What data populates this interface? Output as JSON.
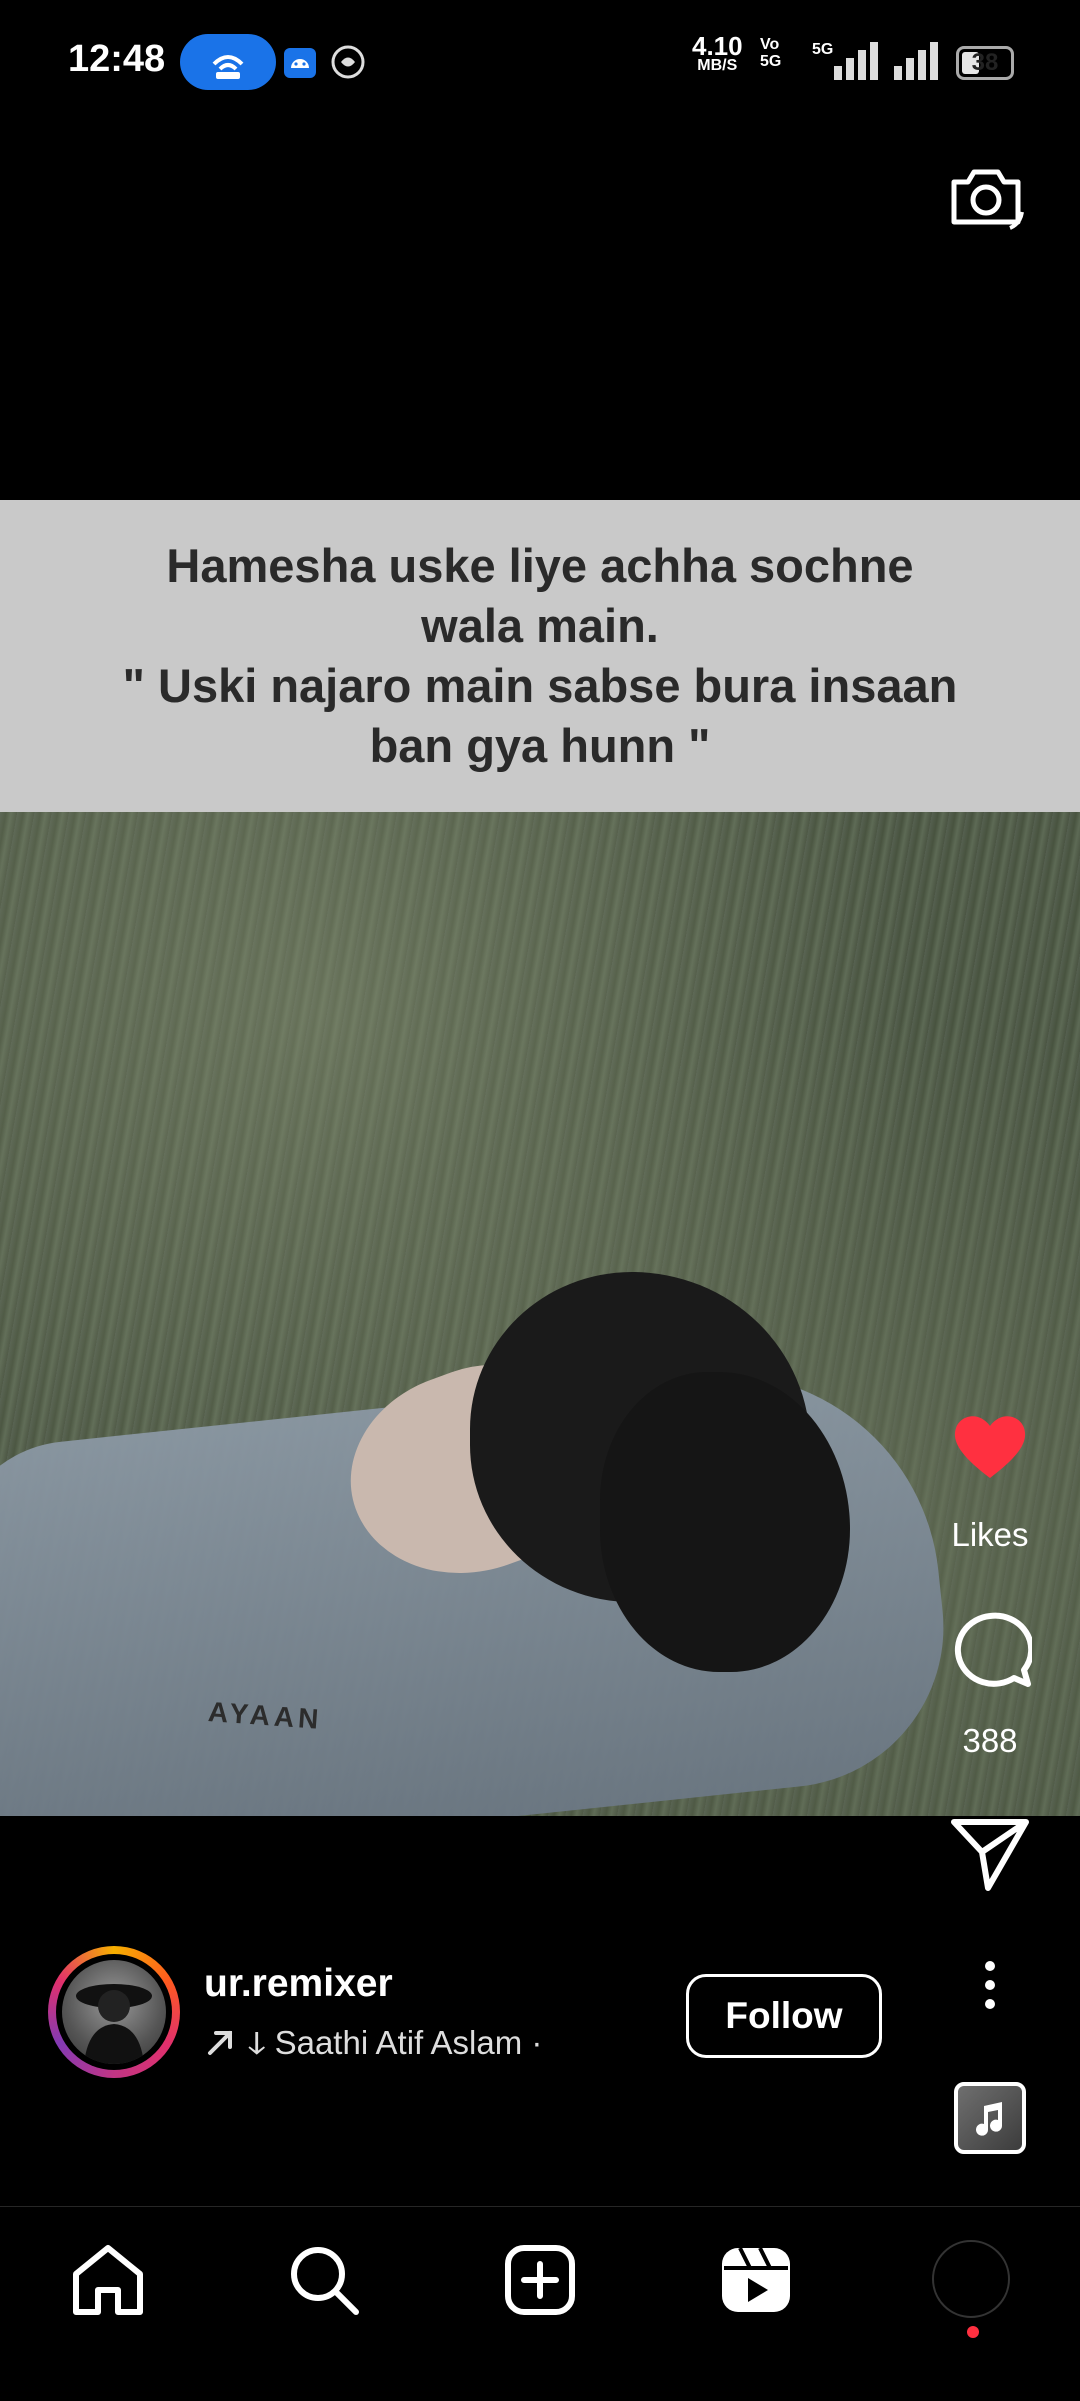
{
  "status_bar": {
    "time": "12:48",
    "net_speed_value": "4.10",
    "net_speed_unit": "MB/S",
    "volte_top": "Vo",
    "volte_bottom": "5G",
    "network": "5G",
    "battery": "38",
    "battery_level": 0.38
  },
  "media": {
    "caption_overlay": "Hamesha  uske liye achha sochne\nwala main.\n\" Uski najaro main sabse bura insaan\nban gya hunn \"",
    "pocket_text": "AYAAN"
  },
  "actions": {
    "likes_label": "Likes",
    "comments_count": "388"
  },
  "author": {
    "username": "ur.remixer",
    "music_text": "ↆ Saathi    Atif Aslam ·",
    "follow_label": "Follow"
  },
  "nav": {
    "items": [
      "home",
      "search",
      "create",
      "reels",
      "profile"
    ]
  },
  "colors": {
    "like_red": "#ff3040",
    "accent_blue": "#1a73e8"
  }
}
